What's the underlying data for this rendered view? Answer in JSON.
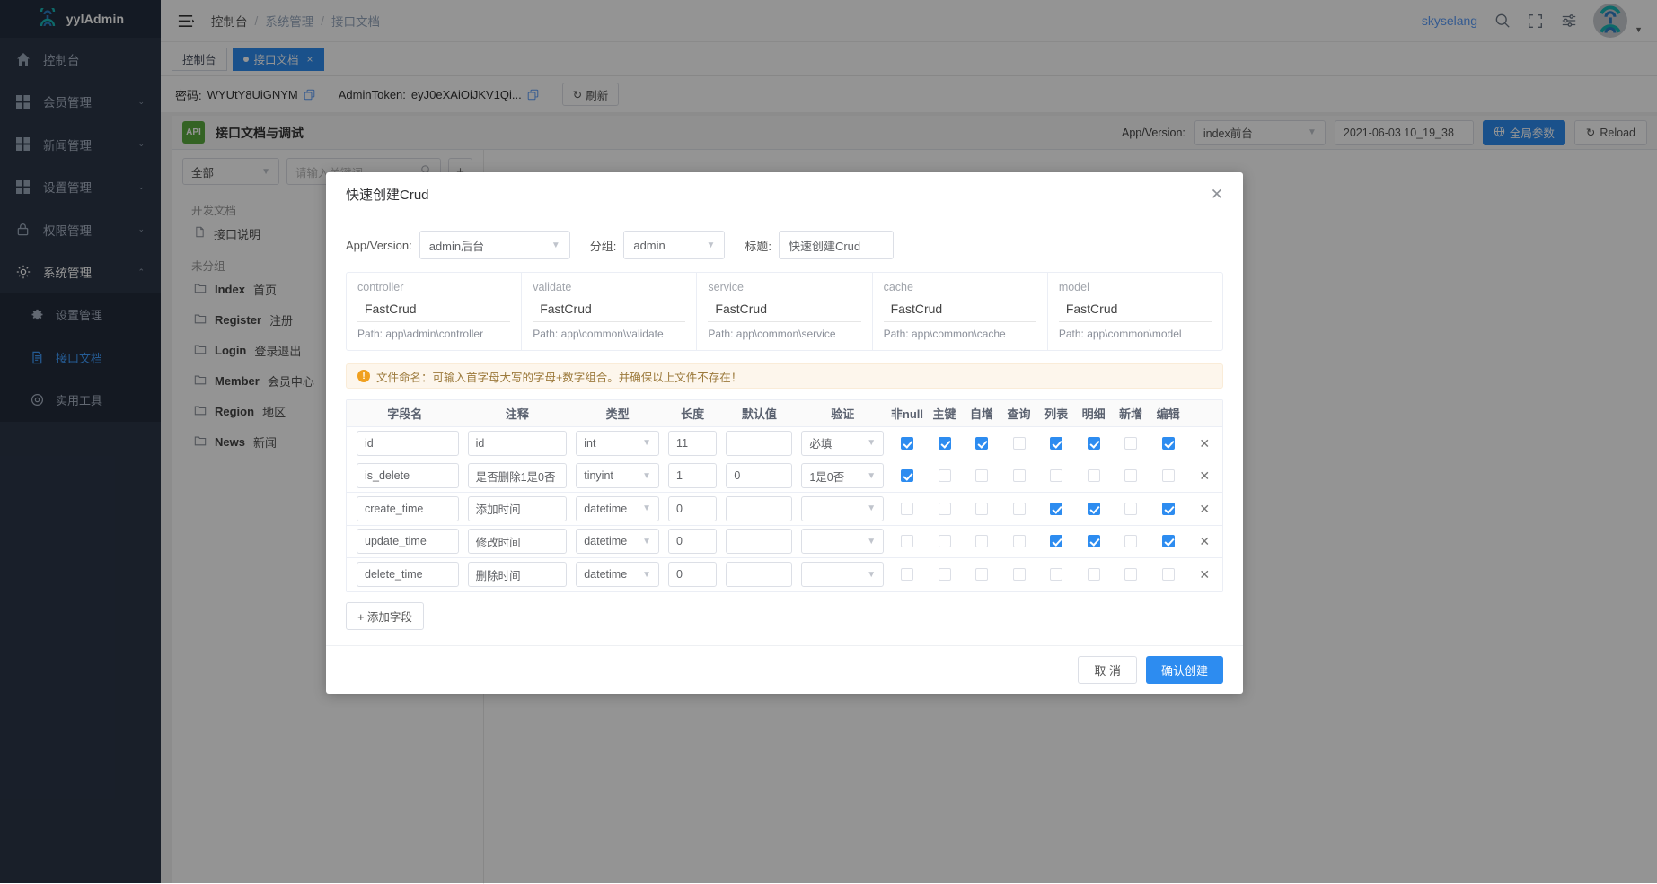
{
  "brand": {
    "name": "yylAdmin"
  },
  "sidebar": {
    "items": [
      {
        "label": "控制台",
        "icon": "home-icon",
        "arrow": ""
      },
      {
        "label": "会员管理",
        "icon": "grid-icon",
        "arrow": "⌄"
      },
      {
        "label": "新闻管理",
        "icon": "grid-icon",
        "arrow": "⌄"
      },
      {
        "label": "设置管理",
        "icon": "grid-icon",
        "arrow": "⌄"
      },
      {
        "label": "权限管理",
        "icon": "lock-icon",
        "arrow": "⌄"
      },
      {
        "label": "系统管理",
        "icon": "gear-icon",
        "arrow": "⌃"
      }
    ],
    "subitems": [
      {
        "label": "设置管理",
        "icon": "gear-icon",
        "active": false
      },
      {
        "label": "接口文档",
        "icon": "doc-icon",
        "active": true
      },
      {
        "label": "实用工具",
        "icon": "tool-icon",
        "active": false
      }
    ]
  },
  "topbar": {
    "breadcrumb": [
      "控制台",
      "系统管理",
      "接口文档"
    ],
    "separator": "/",
    "username": "skyselang",
    "icons": [
      "search-icon",
      "fullscreen-icon",
      "settings-sliders-icon"
    ]
  },
  "tabs": [
    {
      "label": "控制台",
      "active": false,
      "closable": false
    },
    {
      "label": "接口文档",
      "active": true,
      "closable": true,
      "close": "×"
    }
  ],
  "tokenbar": {
    "password_label": "密码:",
    "password_value": "WYUtY8UiGNYM",
    "token_label": "AdminToken:",
    "token_value": "eyJ0eXAiOiJKV1Qi...",
    "refresh_label": "刷新",
    "refresh_icon": "refresh-icon"
  },
  "apidoc": {
    "badge": "API",
    "title": "接口文档与调试",
    "appversion_label": "App/Version:",
    "appversion_value": "index前台",
    "date_value": "2021-06-03 10_19_38",
    "global_params_label": "全局参数",
    "global_params_icon": "globe-icon",
    "reload_label": "Reload",
    "reload_icon": "reload-icon",
    "category_value": "全部",
    "keyword_placeholder": "请输入关键词",
    "search_icon": "search-icon",
    "add_icon": "plus-icon",
    "groups": [
      {
        "title": "开发文档",
        "items": [
          {
            "name": "接口说明",
            "desc": "",
            "icon": "file-icon"
          }
        ]
      },
      {
        "title": "未分组",
        "items": [
          {
            "name": "Index",
            "desc": "首页",
            "icon": "folder-icon"
          },
          {
            "name": "Register",
            "desc": "注册",
            "icon": "folder-icon"
          },
          {
            "name": "Login",
            "desc": "登录退出",
            "icon": "folder-icon"
          },
          {
            "name": "Member",
            "desc": "会员中心",
            "icon": "folder-icon"
          },
          {
            "name": "Region",
            "desc": "地区",
            "icon": "folder-icon"
          },
          {
            "name": "News",
            "desc": "新闻",
            "icon": "folder-icon"
          }
        ]
      }
    ]
  },
  "modal": {
    "title": "快速创建Crud",
    "close_icon": "close-icon",
    "form": {
      "appversion_label": "App/Version:",
      "appversion_value": "admin后台",
      "group_label": "分组:",
      "group_value": "admin",
      "title_label": "标题:",
      "title_value": "快速创建Crud"
    },
    "cards": [
      {
        "key": "controller",
        "value": "FastCrud",
        "path_label": "Path:",
        "path": "app\\admin\\controller"
      },
      {
        "key": "validate",
        "value": "FastCrud",
        "path_label": "Path:",
        "path": "app\\common\\validate"
      },
      {
        "key": "service",
        "value": "FastCrud",
        "path_label": "Path:",
        "path": "app\\common\\service"
      },
      {
        "key": "cache",
        "value": "FastCrud",
        "path_label": "Path:",
        "path": "app\\common\\cache"
      },
      {
        "key": "model",
        "value": "FastCrud",
        "path_label": "Path:",
        "path": "app\\common\\model"
      }
    ],
    "alert": {
      "icon": "warning-icon",
      "text": "文件命名：可输入首字母大写的字母+数字组合。并确保以上文件不存在！"
    },
    "table": {
      "headers": [
        "字段名",
        "注释",
        "类型",
        "长度",
        "默认值",
        "验证",
        "非null",
        "主键",
        "自增",
        "查询",
        "列表",
        "明细",
        "新增",
        "编辑",
        ""
      ],
      "rows": [
        {
          "name": "id",
          "note": "id",
          "type": "int",
          "length": "11",
          "default": "",
          "validate": "必填",
          "notnull": true,
          "pk": true,
          "ai": true,
          "query": false,
          "list": true,
          "detail": true,
          "add": false,
          "edit": true,
          "delete_icon": "close-icon"
        },
        {
          "name": "is_delete",
          "note": "是否删除1是0否",
          "type": "tinyint",
          "length": "1",
          "default": "0",
          "validate": "1是0否",
          "notnull": true,
          "pk": false,
          "ai": false,
          "query": false,
          "list": false,
          "detail": false,
          "add": false,
          "edit": false,
          "delete_icon": "close-icon"
        },
        {
          "name": "create_time",
          "note": "添加时间",
          "type": "datetime",
          "length": "0",
          "default": "",
          "validate": "",
          "notnull": false,
          "pk": false,
          "ai": false,
          "query": false,
          "list": true,
          "detail": true,
          "add": false,
          "edit": true,
          "delete_icon": "close-icon"
        },
        {
          "name": "update_time",
          "note": "修改时间",
          "type": "datetime",
          "length": "0",
          "default": "",
          "validate": "",
          "notnull": false,
          "pk": false,
          "ai": false,
          "query": false,
          "list": true,
          "detail": true,
          "add": false,
          "edit": true,
          "delete_icon": "close-icon"
        },
        {
          "name": "delete_time",
          "note": "删除时间",
          "type": "datetime",
          "length": "0",
          "default": "",
          "validate": "",
          "notnull": false,
          "pk": false,
          "ai": false,
          "query": false,
          "list": false,
          "detail": false,
          "add": false,
          "edit": false,
          "delete_icon": "close-icon"
        }
      ]
    },
    "add_field_label": "+ 添加字段",
    "cancel_label": "取 消",
    "confirm_label": "确认创建"
  },
  "colors": {
    "primary": "#2d8cf0",
    "sidebar": "#2b3648",
    "sidebar_dark": "#242e3e",
    "link": "#5a9cf8",
    "warn_bg": "#fdf6ec",
    "api_green": "#5aab3e"
  }
}
